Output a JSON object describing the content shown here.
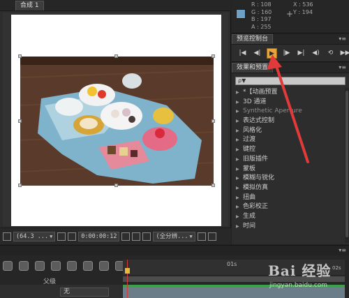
{
  "composition": {
    "tab_label": "合成 1",
    "footer": {
      "zoom": "(64.3 ...",
      "timecode": "0:00:00:12",
      "resolution": "(全分辨...",
      "zoom_arrow": "▼",
      "resolution_arrow": "▼"
    }
  },
  "info": {
    "r": "R : 108",
    "g": "G : 160",
    "b": "B : 197",
    "a": "A : 255",
    "x": "X : 536",
    "y": "Y : 194",
    "swatch_color": "#6ca0c5"
  },
  "preview": {
    "title": "预览控制台",
    "buttons": [
      "first-frame",
      "previous-frame",
      "play",
      "next-frame",
      "last-frame",
      "audio",
      "loop",
      "ram-preview"
    ]
  },
  "effects": {
    "title": "效果和预置",
    "search_placeholder": "ρ▼",
    "items": [
      {
        "label": "*【动画预置",
        "dim": false
      },
      {
        "label": "3D 通道",
        "dim": false
      },
      {
        "label": "Synthetic Aperture",
        "dim": true
      },
      {
        "label": "表达式控制",
        "dim": false
      },
      {
        "label": "风格化",
        "dim": false
      },
      {
        "label": "过渡",
        "dim": false
      },
      {
        "label": "键控",
        "dim": false
      },
      {
        "label": "旧版插件",
        "dim": false
      },
      {
        "label": "蒙板",
        "dim": false
      },
      {
        "label": "模糊与锐化",
        "dim": false
      },
      {
        "label": "模拟仿真",
        "dim": false
      },
      {
        "label": "扭曲",
        "dim": false
      },
      {
        "label": "色彩校正",
        "dim": false
      },
      {
        "label": "生成",
        "dim": false
      },
      {
        "label": "时间",
        "dim": false
      }
    ]
  },
  "timeline": {
    "ruler_mark": "01s",
    "ruler_end": "02s",
    "parent_column": "父级",
    "parent_value": "无"
  },
  "watermark": {
    "logo": "Bai 经验",
    "url": "jingyan.baidu.com"
  },
  "colors": {
    "accent_play": "#e8a33a",
    "annotation_red": "#e03a3a",
    "track_green": "#3aa14a"
  }
}
